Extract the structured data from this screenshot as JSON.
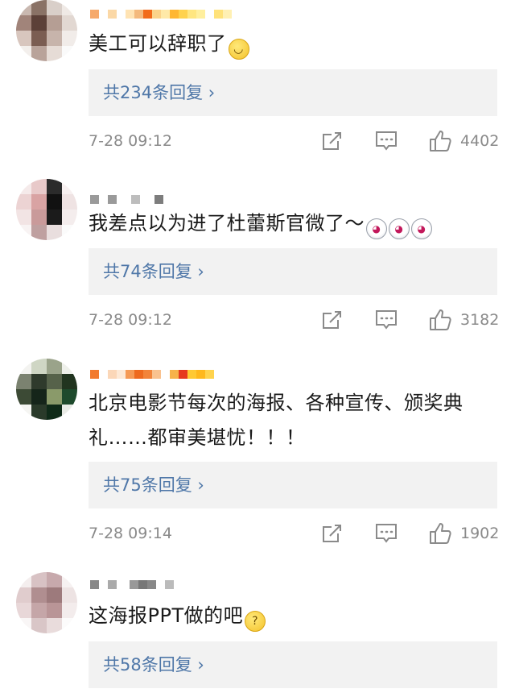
{
  "comments": [
    {
      "text": "美工可以辞职了",
      "emojis": [
        "smile"
      ],
      "replies_label": "共234条回复 ›",
      "time": "7-28 09:12",
      "likes": "4402"
    },
    {
      "text": "我差点以为进了杜蕾斯官微了～",
      "emojis": [
        "panda",
        "panda",
        "panda"
      ],
      "replies_label": "共74条回复 ›",
      "time": "7-28 09:12",
      "likes": "3182"
    },
    {
      "text": "北京电影节每次的海报、各种宣传、颁奖典礼……都审美堪忧！！！",
      "emojis": [],
      "replies_label": "共75条回复 ›",
      "time": "7-28 09:14",
      "likes": "1902"
    },
    {
      "text": "这海报PPT做的吧",
      "emojis": [
        "think"
      ],
      "replies_label": "共58条回复 ›"
    }
  ],
  "icons": {
    "share": "share-icon",
    "comment": "comment-icon",
    "like": "thumbs-up-icon"
  },
  "colors": {
    "reply_link": "#4f77a8",
    "meta_gray": "#8a8a8a",
    "reply_bg": "#f2f2f2"
  }
}
